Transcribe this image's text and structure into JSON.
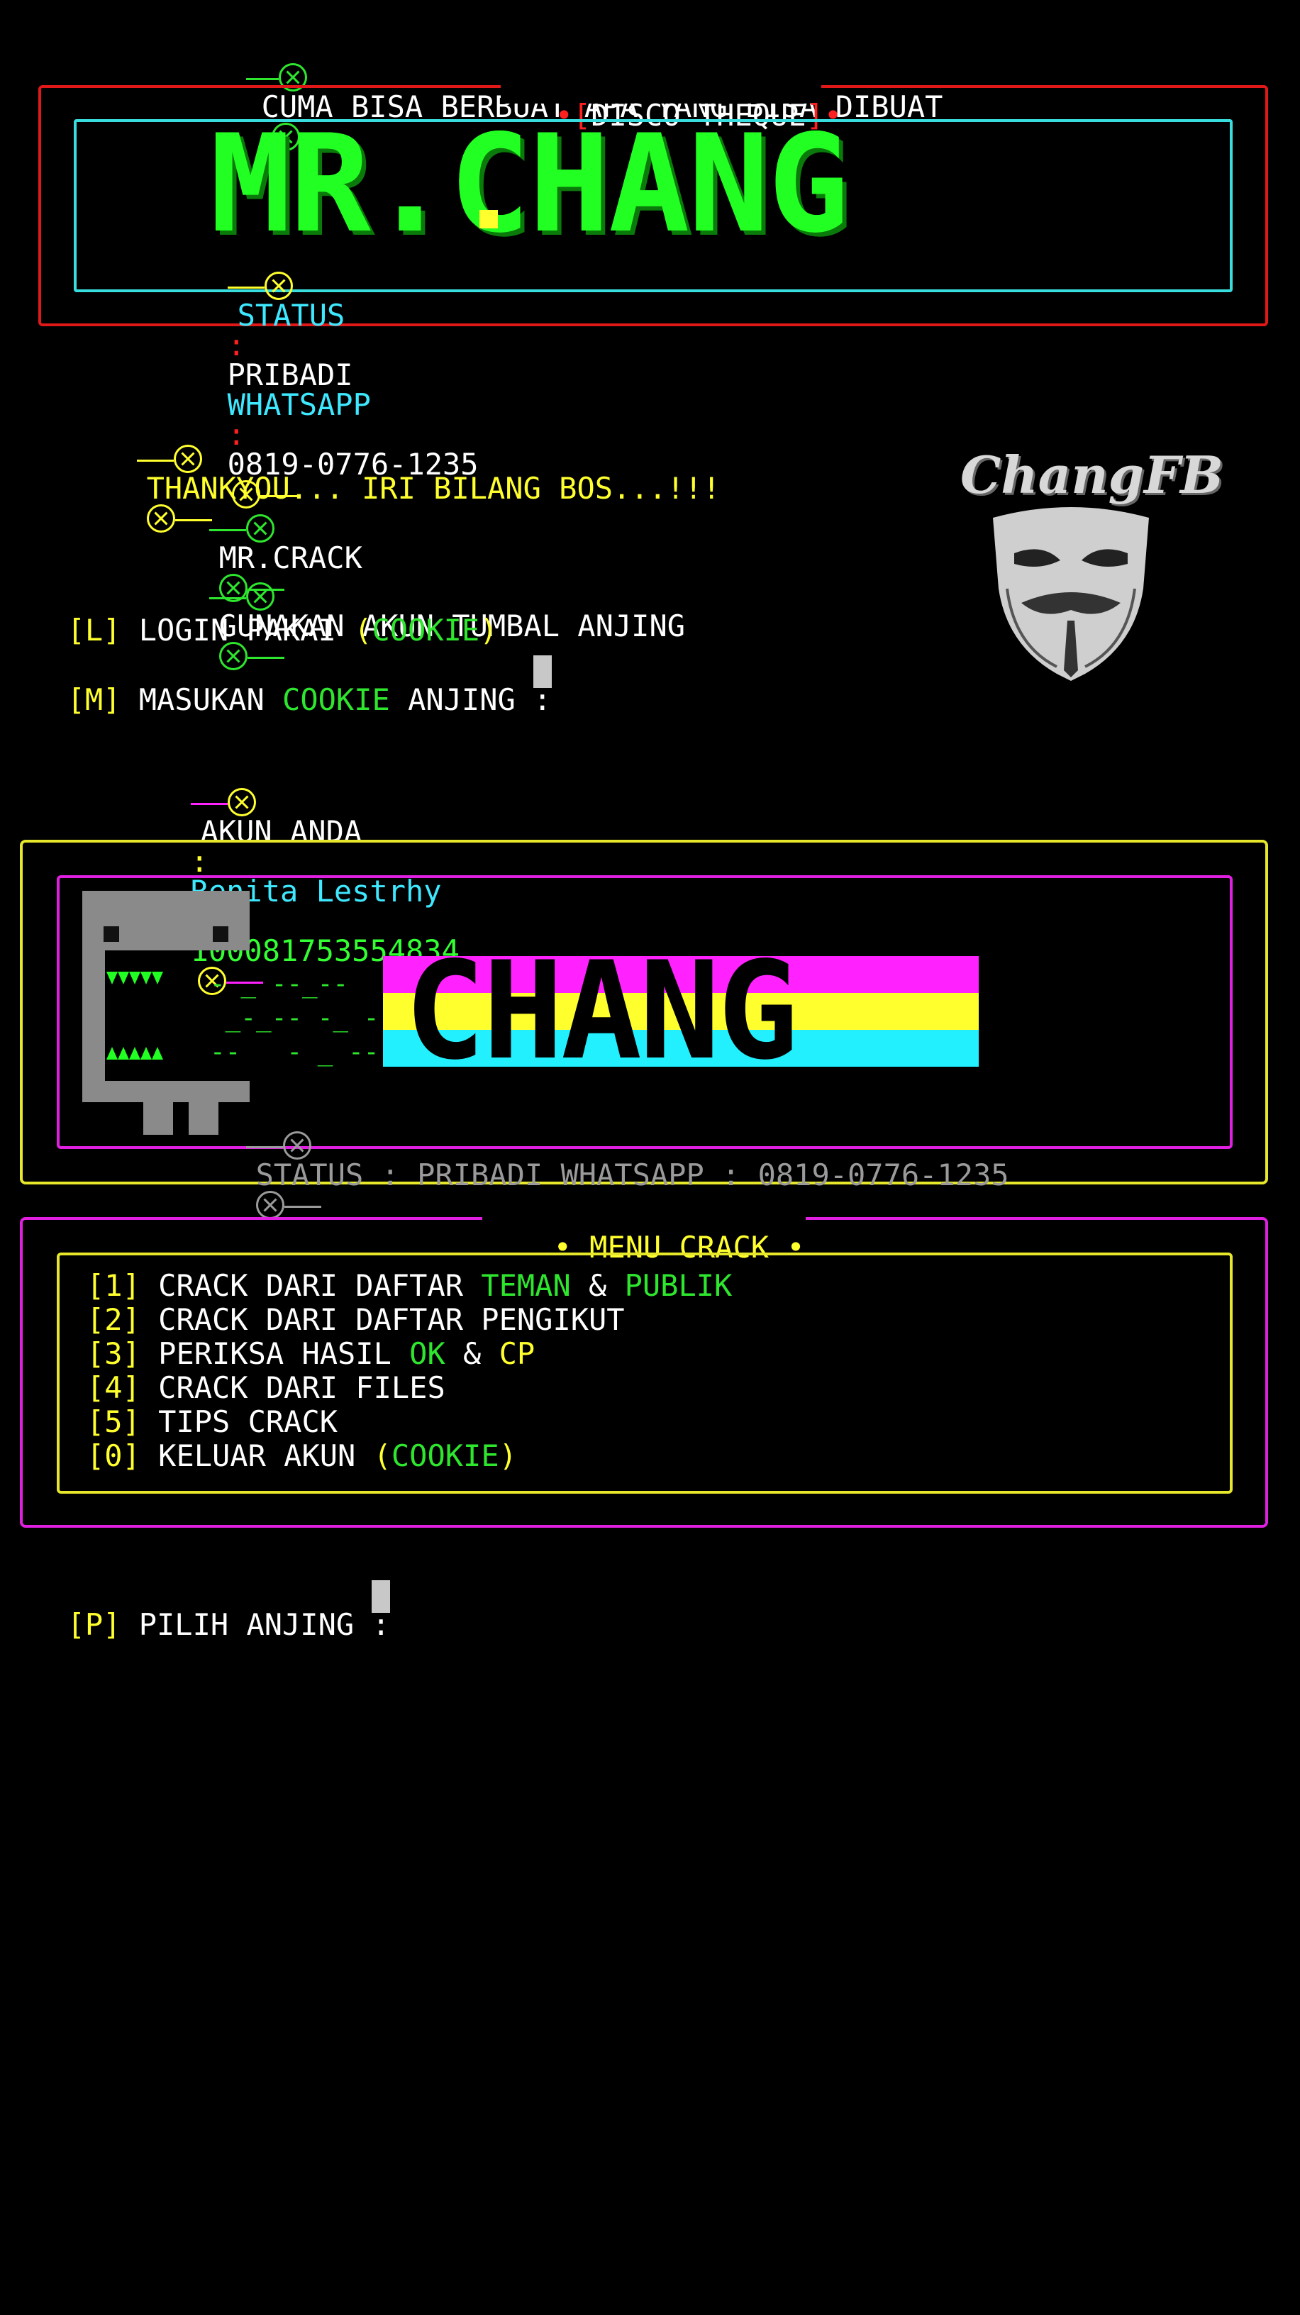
{
  "header": {
    "tagline": "CUMA BISA BERBUAT APA YANG BISA DIBUAT",
    "frame_label_bracket_open": "[",
    "frame_label": "DISCO THEQUE",
    "frame_label_bracket_close": "]",
    "banner_title": "MR.CHANG",
    "status_label": "STATUS",
    "status_value": "PRIBADI",
    "whatsapp_label": "WHATSAPP",
    "whatsapp_number": "0819-0776-1235",
    "separator": ":"
  },
  "messages": {
    "thankyou": "THANKYOU... IRI BILANG BOS...!!!",
    "author": "MR.CRACK",
    "instruction": "GUNAKAN AKUN TUMBAL ANJING"
  },
  "logo": {
    "text": "ChangFB"
  },
  "login": {
    "option_key": "[L]",
    "option_text": "LOGIN PAKAI",
    "option_open": "(",
    "option_cookie": "COOKIE",
    "option_close": ")",
    "prompt_key": "[M]",
    "prompt_text_1": "MASUKAN",
    "prompt_cookie": "COOKIE",
    "prompt_text_2": "ANJING :"
  },
  "account": {
    "label": "AKUN ANDA",
    "separator": ":",
    "name": "Renita Lestrhy",
    "id": "100081753554834"
  },
  "banner2": {
    "title": "CHANG",
    "status_line": "STATUS : PRIBADI WHATSAPP : 0819-0776-1235"
  },
  "menu": {
    "title": "MENU CRACK",
    "items": [
      {
        "key": "[1]",
        "parts": [
          {
            "text": "CRACK DARI DAFTAR ",
            "color": "#ffffff"
          },
          {
            "text": "TEMAN",
            "color": "#2ee62e"
          },
          {
            "text": " & ",
            "color": "#ffffff"
          },
          {
            "text": "PUBLIK",
            "color": "#2ee62e"
          }
        ]
      },
      {
        "key": "[2]",
        "parts": [
          {
            "text": "CRACK DARI DAFTAR PENGIKUT",
            "color": "#ffffff"
          }
        ]
      },
      {
        "key": "[3]",
        "parts": [
          {
            "text": "PERIKSA HASIL ",
            "color": "#ffffff"
          },
          {
            "text": "OK",
            "color": "#2ee62e"
          },
          {
            "text": " & ",
            "color": "#ffffff"
          },
          {
            "text": "CP",
            "color": "#ffff2e"
          }
        ]
      },
      {
        "key": "[4]",
        "parts": [
          {
            "text": "CRACK DARI FILES",
            "color": "#ffffff"
          }
        ]
      },
      {
        "key": "[5]",
        "parts": [
          {
            "text": "TIPS CRACK",
            "color": "#ffffff"
          }
        ]
      },
      {
        "key": "[0]",
        "parts": [
          {
            "text": "KELUAR AKUN ",
            "color": "#ffffff"
          },
          {
            "text": "(",
            "color": "#ffff2e"
          },
          {
            "text": "COOKIE",
            "color": "#2ee62e"
          },
          {
            "text": ")",
            "color": "#ffff2e"
          }
        ]
      }
    ]
  },
  "prompt": {
    "key": "[P]",
    "text": "PILIH ANJING :"
  },
  "colors": {
    "background": "#000000",
    "yellow": "#ffff2e",
    "green": "#2ee62e",
    "cyan": "#3ee8ff",
    "red": "#ff2020",
    "magenta": "#ff22ff"
  }
}
